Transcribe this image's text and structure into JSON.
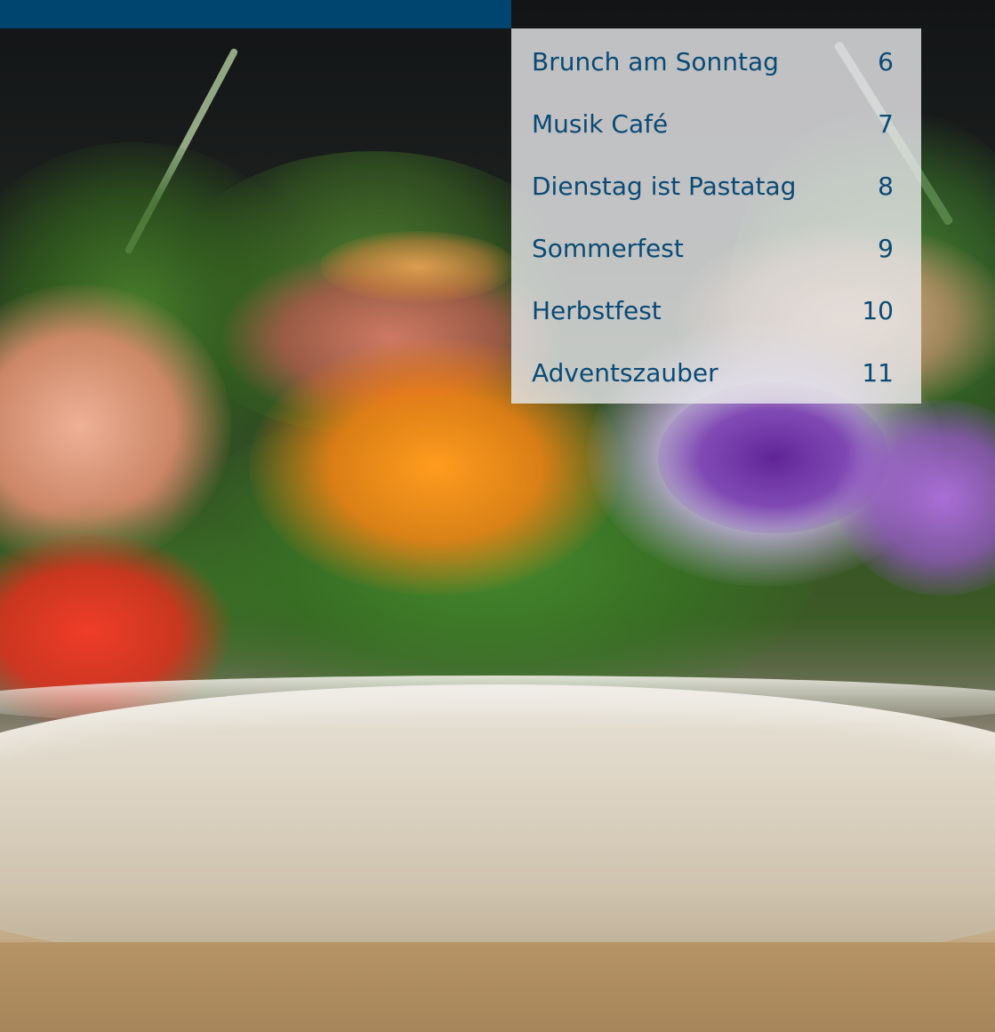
{
  "toc": {
    "items": [
      {
        "title": "Brunch am Sonntag",
        "page": "6"
      },
      {
        "title": "Musik Café",
        "page": "7"
      },
      {
        "title": "Dienstag ist Pastatag",
        "page": "8"
      },
      {
        "title": "Sommerfest",
        "page": "9"
      },
      {
        "title": "Herbstfest",
        "page": "10"
      },
      {
        "title": "Adventszauber",
        "page": "11"
      }
    ]
  },
  "colors": {
    "accent_blue": "#004570",
    "toc_text": "#0b4a74",
    "toc_panel": "#e6e7e9"
  }
}
